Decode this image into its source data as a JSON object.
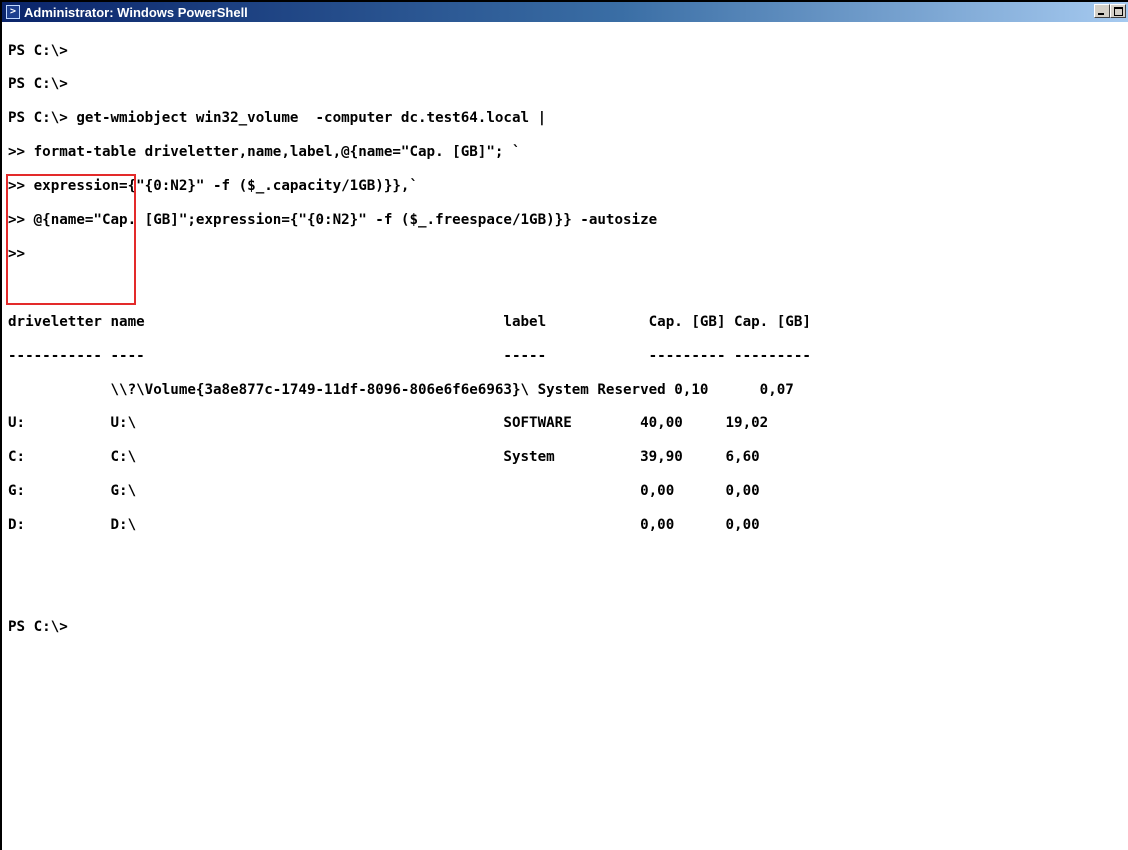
{
  "window": {
    "title": "Administrator: Windows PowerShell",
    "icon": "powershell-icon",
    "controls": [
      "minimize",
      "maximize"
    ]
  },
  "console": {
    "prompt_lines": [
      "PS C:\\>",
      "PS C:\\>",
      "PS C:\\> get-wmiobject win32_volume  -computer dc.test64.local |",
      ">> format-table driveletter,name,label,@{name=\"Cap. [GB]\"; `",
      ">> expression={\"{0:N2}\" -f ($_.capacity/1GB)}},`",
      ">> @{name=\"Cap. [GB]\";expression={\"{0:N2}\" -f ($_.freespace/1GB)}} -autosize",
      ">>"
    ],
    "table": {
      "header": "driveletter name                                          label            Cap. [GB] Cap. [GB]",
      "separator": "----------- ----                                          -----            --------- ---------",
      "rows": [
        "            \\\\?\\Volume{3a8e877c-1749-11df-8096-806e6f6e6963}\\ System Reserved 0,10      0,07",
        "U:          U:\\                                           SOFTWARE        40,00     19,02",
        "C:          C:\\                                           System          39,90     6,60",
        "G:          G:\\                                                           0,00      0,00",
        "D:          D:\\                                                           0,00      0,00"
      ]
    },
    "final_prompt": "PS C:\\>"
  },
  "annotation": {
    "highlight_color": "#e32a2a"
  }
}
